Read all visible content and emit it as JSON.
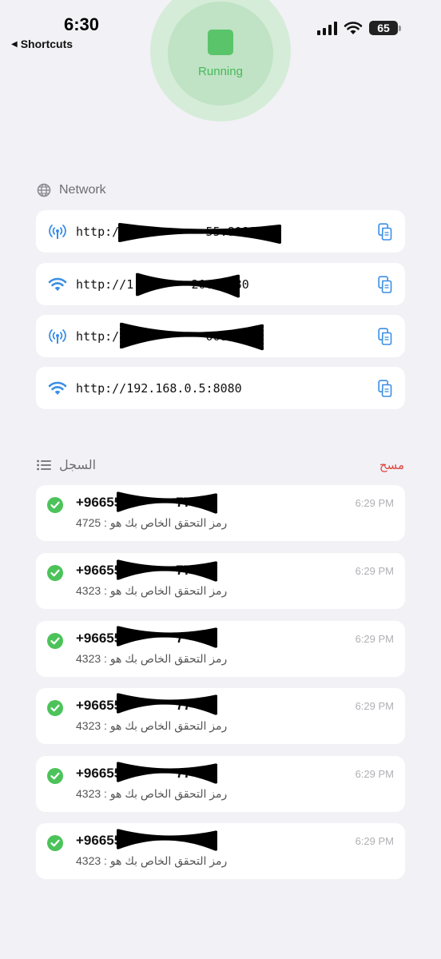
{
  "status_bar": {
    "time": "6:30",
    "back_label": "Shortcuts",
    "battery": "65"
  },
  "server": {
    "status": "Running",
    "accent": "#5ac46a"
  },
  "network": {
    "title": "Network",
    "items": [
      {
        "icon": "antenna-icon",
        "url": "http://1          55:8080"
      },
      {
        "icon": "wifi-icon",
        "url": "http://1        20.:8080"
      },
      {
        "icon": "antenna-icon",
        "url": "http://           0080"
      },
      {
        "icon": "wifi-icon",
        "url": "http://192.168.0.5:8080"
      }
    ]
  },
  "log": {
    "title": "السجل",
    "clear_label": "مسح",
    "entries": [
      {
        "phone": "+96655        77",
        "message": "رمز التحقق الخاص بك هو : 4725",
        "time": "6:29 PM"
      },
      {
        "phone": "+96655        77",
        "message": "رمز التحقق الخاص بك هو : 4323",
        "time": "6:29 PM"
      },
      {
        "phone": "+96655        7",
        "message": "رمز التحقق الخاص بك هو : 4323",
        "time": "6:29 PM"
      },
      {
        "phone": "+96655        77",
        "message": "رمز التحقق الخاص بك هو : 4323",
        "time": "6:29 PM"
      },
      {
        "phone": "+96655        77",
        "message": "رمز التحقق الخاص بك هو : 4323",
        "time": "6:29 PM"
      },
      {
        "phone": "+96655",
        "message": "رمز التحقق الخاص بك هو : 4323",
        "time": "6:29 PM"
      }
    ]
  }
}
